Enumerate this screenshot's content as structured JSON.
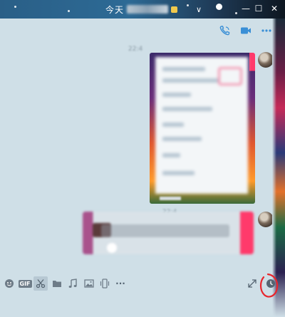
{
  "window": {
    "title": "今天",
    "title_suffix_chevron": "∨",
    "controls": {
      "minimize": "—",
      "maximize": "☐",
      "close": "✕"
    }
  },
  "chat_header": {
    "icons": [
      "phone-icon",
      "video-call-icon",
      "more-icon"
    ]
  },
  "messages": [
    {
      "type": "timestamp",
      "text": "22:4"
    },
    {
      "type": "image",
      "sender": "self"
    },
    {
      "type": "timestamp",
      "text": "22:4"
    },
    {
      "type": "text",
      "sender": "self"
    }
  ],
  "toolbar": {
    "gif_label": "GIF",
    "more_label": "···",
    "icons": [
      "emoji-icon",
      "gif-icon",
      "screenshot-scissors-icon",
      "folder-icon",
      "music-icon",
      "image-icon",
      "phone-screen-icon",
      "more-icon",
      "expand-icon",
      "history-clock-icon"
    ]
  },
  "colors": {
    "titlebar": "#2a5f87",
    "chat_background": "#cfdfe7",
    "accent_icon": "#3a8fd6",
    "annotation_red": "#e8262d"
  }
}
